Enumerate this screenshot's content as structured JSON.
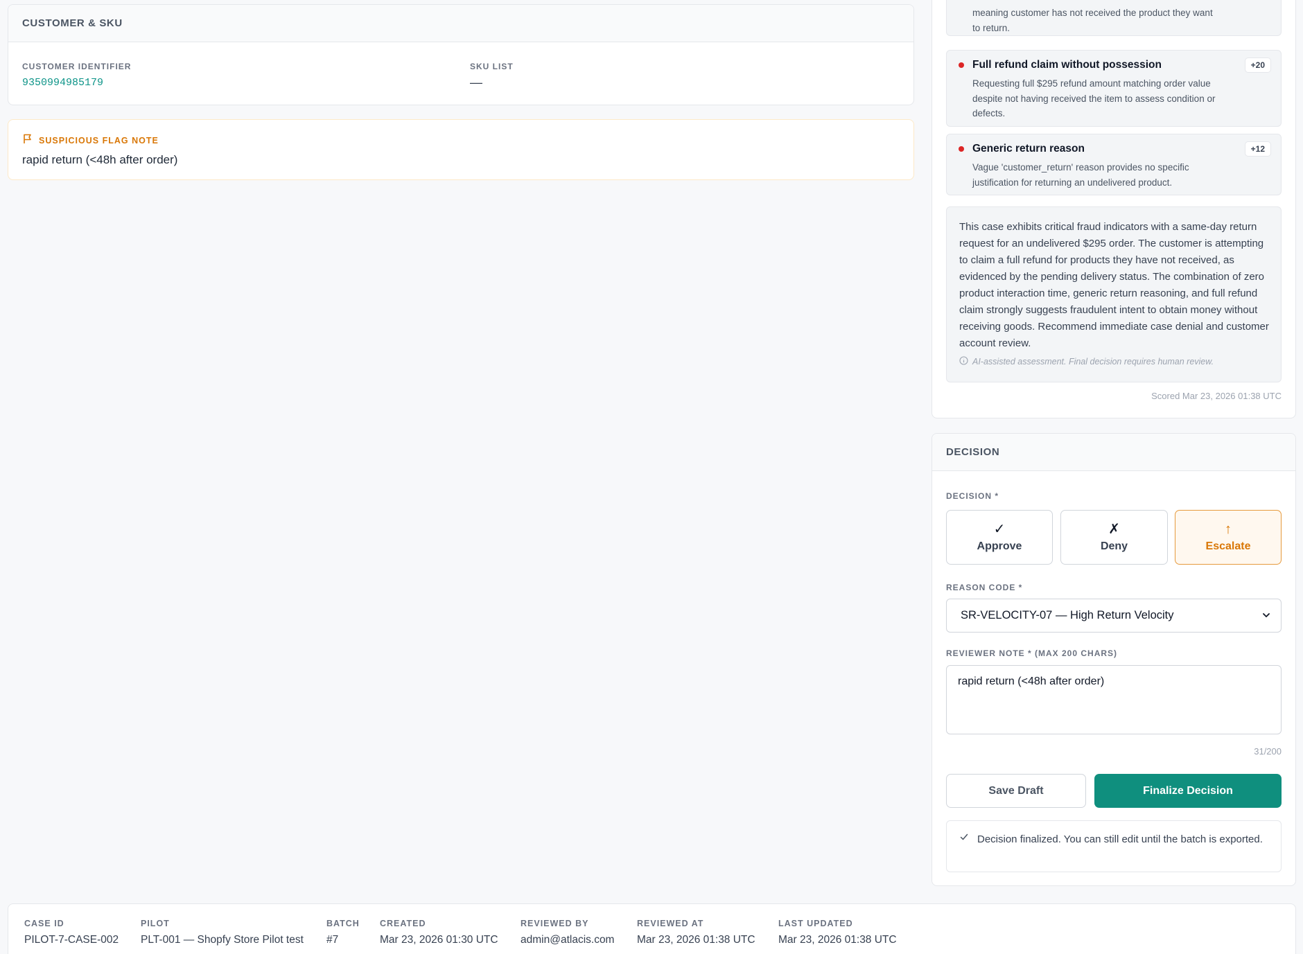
{
  "customer_sku": {
    "title": "CUSTOMER & SKU",
    "customer_identifier_label": "CUSTOMER IDENTIFIER",
    "customer_identifier_value": "9350994985179",
    "sku_list_label": "SKU LIST",
    "sku_list_value": "—"
  },
  "flag_note": {
    "title": "SUSPICIOUS FLAG NOTE",
    "text": "rapid return (<48h after order)"
  },
  "risk": {
    "partial_factor_desc": "meaning customer has not received the product they want to return.",
    "factors": [
      {
        "title": "Full refund claim without possession",
        "points": "+20",
        "description": "Requesting full $295 refund amount matching order value despite not having received the item to assess condition or defects."
      },
      {
        "title": "Generic return reason",
        "points": "+12",
        "description": "Vague 'customer_return' reason provides no specific justification for returning an undelivered product."
      }
    ],
    "summary": "This case exhibits critical fraud indicators with a same-day return request for an undelivered $295 order. The customer is attempting to claim a full refund for products they have not received, as evidenced by the pending delivery status. The combination of zero product interaction time, generic return reasoning, and full refund claim strongly suggests fraudulent intent to obtain money without receiving goods. Recommend immediate case denial and customer account review.",
    "disclaimer": "AI-assisted assessment. Final decision requires human review.",
    "scored_at": "Scored Mar 23, 2026 01:38 UTC"
  },
  "decision": {
    "title": "DECISION",
    "decision_label": "DECISION *",
    "options": [
      {
        "glyph": "✓",
        "label": "Approve"
      },
      {
        "glyph": "✗",
        "label": "Deny"
      },
      {
        "glyph": "↑",
        "label": "Escalate"
      }
    ],
    "selected": "Escalate",
    "reason_code_label": "REASON CODE *",
    "reason_code_value": "SR-VELOCITY-07 — High Return Velocity",
    "reviewer_note_label": "REVIEWER NOTE * (MAX 200 CHARS)",
    "reviewer_note_value": "rapid return (<48h after order)",
    "char_count": "31/200",
    "save_draft_label": "Save Draft",
    "finalize_label": "Finalize Decision",
    "notice": "Decision finalized. You can still edit until the batch is exported.",
    "accent_color": "#0f8f7e",
    "escalate_color": "#d97706"
  },
  "meta": {
    "case_id_label": "CASE ID",
    "case_id": "PILOT-7-CASE-002",
    "pilot_label": "PILOT",
    "pilot": "PLT-001 — Shopfy Store Pilot test",
    "batch_label": "BATCH",
    "batch": "#7",
    "created_label": "CREATED",
    "created": "Mar 23, 2026 01:30 UTC",
    "reviewed_by_label": "REVIEWED BY",
    "reviewed_by": "admin@atlacis.com",
    "reviewed_at_label": "REVIEWED AT",
    "reviewed_at": "Mar 23, 2026 01:38 UTC",
    "last_updated_label": "LAST UPDATED",
    "last_updated": "Mar 23, 2026 01:38 UTC"
  }
}
